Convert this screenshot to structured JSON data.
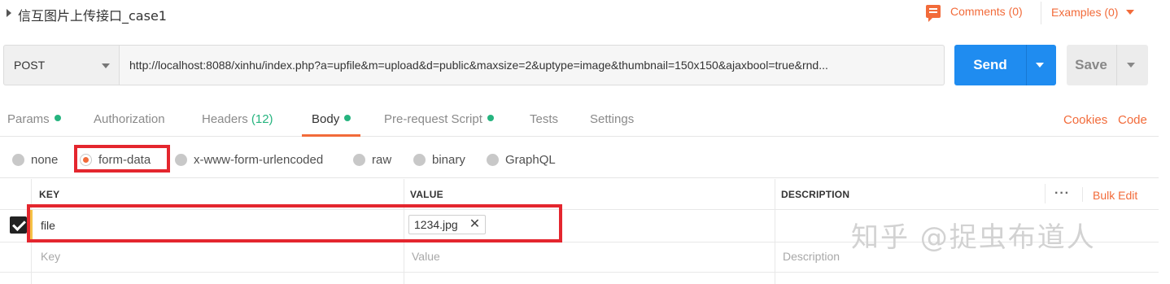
{
  "request": {
    "title": "信互图片上传接口_case1",
    "comments_label": "Comments (0)",
    "examples_label": "Examples (0)"
  },
  "url_bar": {
    "method": "POST",
    "url": "http://localhost:8088/xinhu/index.php?a=upfile&m=upload&d=public&maxsize=2&uptype=image&thumbnail=150x150&ajaxbool=true&rnd...",
    "send_label": "Send",
    "save_label": "Save"
  },
  "tabs": [
    {
      "label": "Params",
      "dot": true
    },
    {
      "label": "Authorization"
    },
    {
      "label": "Headers",
      "count": "(12)"
    },
    {
      "label": "Body",
      "dot": true,
      "active": true
    },
    {
      "label": "Pre-request Script",
      "dot": true
    },
    {
      "label": "Tests"
    },
    {
      "label": "Settings"
    }
  ],
  "tab_links": {
    "cookies": "Cookies",
    "code": "Code"
  },
  "body_types": {
    "options": [
      "none",
      "form-data",
      "x-www-form-urlencoded",
      "raw",
      "binary",
      "GraphQL"
    ],
    "selected": "form-data"
  },
  "table": {
    "headers": {
      "key": "KEY",
      "value": "VALUE",
      "description": "DESCRIPTION"
    },
    "more_icon": "···",
    "bulk_edit": "Bulk Edit",
    "rows": [
      {
        "checked": true,
        "key": "file",
        "value": "1234.jpg",
        "value_type": "file"
      }
    ],
    "placeholders": {
      "key": "Key",
      "value": "Value",
      "description": "Description"
    }
  },
  "watermark": "知乎 @捉虫布道人",
  "colors": {
    "accent": "#f26b3a",
    "send_blue": "#1f8cf0",
    "highlight_red": "#e4262e",
    "status_green": "#26b47f"
  }
}
